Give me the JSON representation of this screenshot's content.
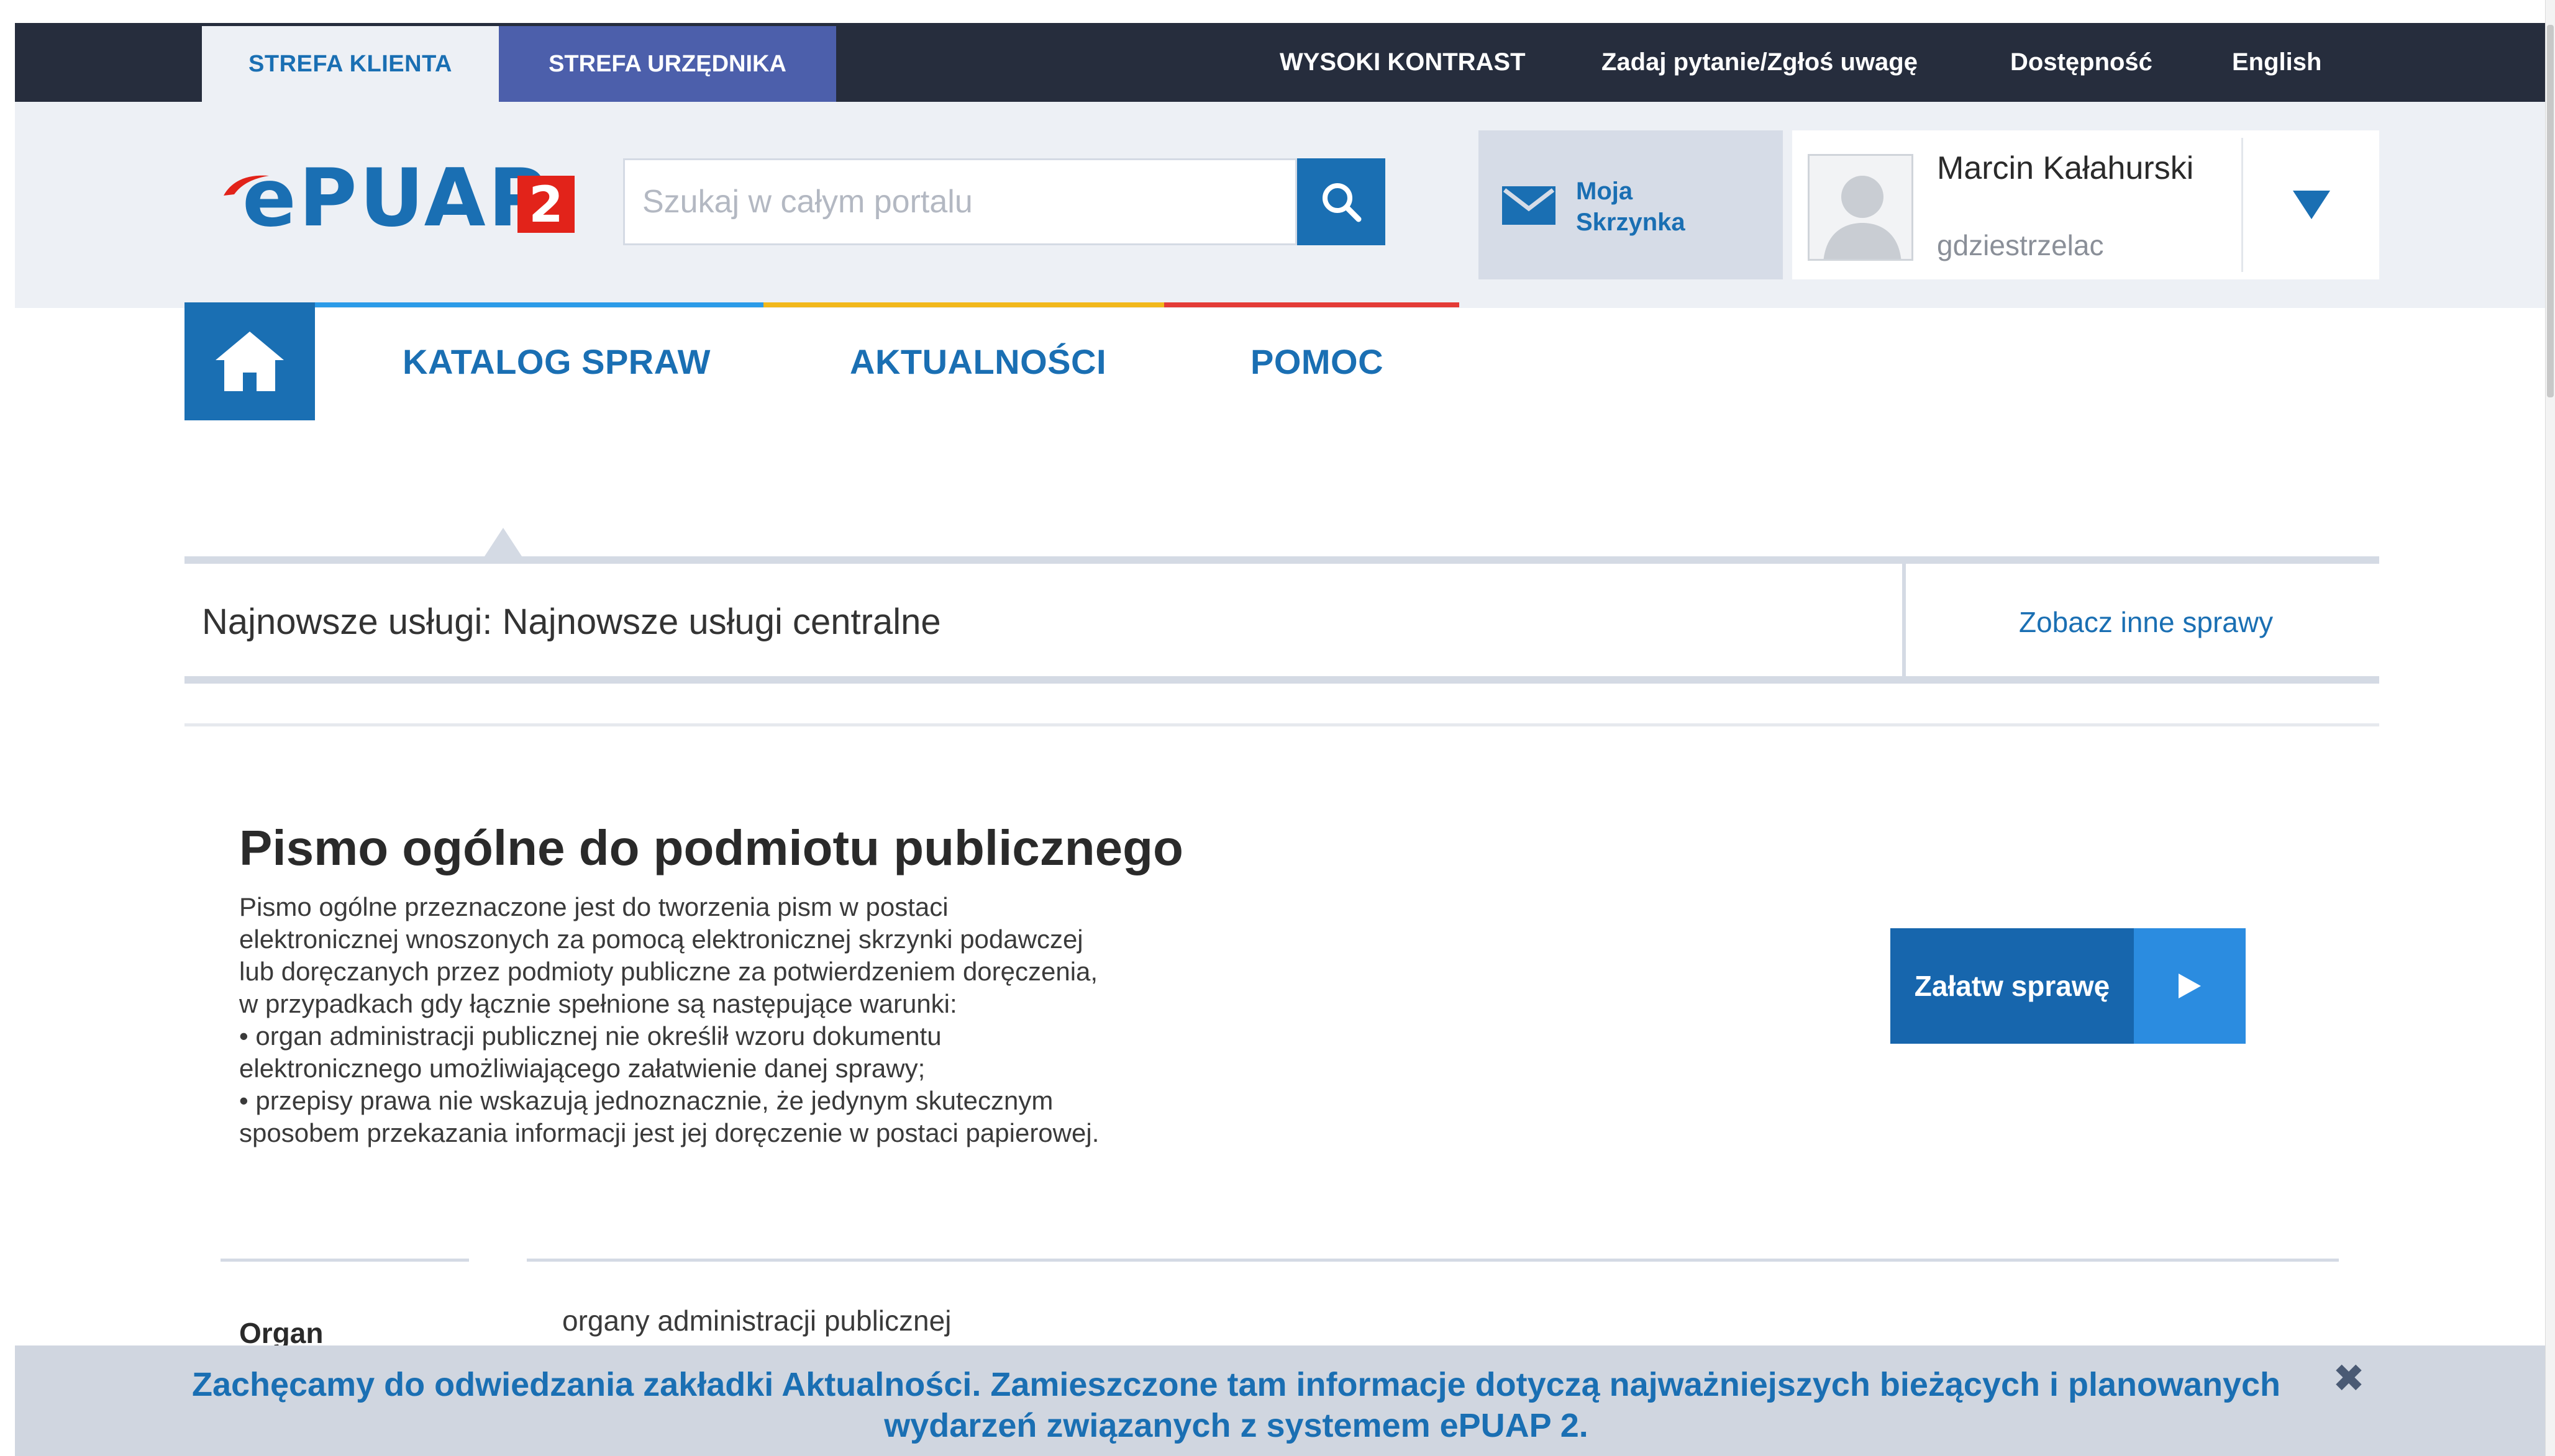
{
  "topbar": {
    "tab_client": "STREFA KLIENTA",
    "tab_official": "STREFA URZĘDNIKA",
    "high_contrast": "WYSOKI KONTRAST",
    "ask_question": "Zadaj pytanie/Zgłoś uwagę",
    "accessibility": "Dostępność",
    "english": "English"
  },
  "header": {
    "logo_text": "ePUAP",
    "logo_badge": "2",
    "search_placeholder": "Szukaj w całym portalu",
    "mailbox_label": "Moja Skrzynka",
    "user_name": "Marcin Kałahurski",
    "user_login": "gdziestrzelac"
  },
  "nav": {
    "items": [
      {
        "label": "KATALOG SPRAW",
        "color": "#2b9be8"
      },
      {
        "label": "AKTUALNOŚCI",
        "color": "#f2b81b"
      },
      {
        "label": "POMOC",
        "color": "#e43b37"
      }
    ]
  },
  "services_bar": {
    "title": "Najnowsze usługi: Najnowsze usługi centralne",
    "see_more": "Zobacz inne sprawy"
  },
  "service_card": {
    "title": "Pismo ogólne do podmiotu publicznego",
    "description_lines": [
      "Pismo ogólne przeznaczone jest do tworzenia pism w postaci",
      "elektronicznej wnoszonych za pomocą elektronicznej skrzynki podawczej",
      "lub doręczanych przez podmioty publiczne za potwierdzeniem doręczenia,",
      "w przypadkach gdy łącznie spełnione są następujące warunki:",
      "• organ administracji publicznej nie określił wzoru dokumentu",
      "elektronicznego umożliwiającego załatwienie danej sprawy;",
      "• przepisy prawa nie wskazują jednoznacznie, że jedynym skutecznym",
      "sposobem przekazania informacji jest jej doręczenie w postaci papierowej."
    ],
    "action_label": "Załatw sprawę",
    "organ_label": "Organ",
    "organ_value": "organy administracji publicznej"
  },
  "notice": {
    "text": "Zachęcamy do odwiedzania zakładki Aktualności. Zamieszczone tam informacje dotyczą najważniejszych bieżących i planowanych wydarzeń związanych z systemem ePUAP 2.",
    "close_icon": "close-icon"
  },
  "colors": {
    "brand_blue": "#1a6fb3",
    "topbar_dark": "#262d3d",
    "official_tab": "#4c5fab",
    "logo_red": "#e2231a"
  }
}
